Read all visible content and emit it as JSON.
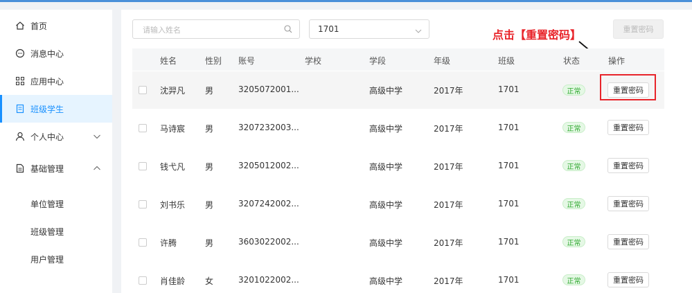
{
  "sidebar": {
    "items": [
      {
        "label": "首页",
        "icon": "home-icon"
      },
      {
        "label": "消息中心",
        "icon": "message-icon"
      },
      {
        "label": "应用中心",
        "icon": "apps-icon"
      },
      {
        "label": "班级学生",
        "icon": "document-icon",
        "active": true
      },
      {
        "label": "个人中心",
        "icon": "user-icon",
        "expand": "down"
      },
      {
        "label": "基础管理",
        "icon": "file-icon",
        "expand": "up"
      }
    ],
    "subitems": [
      {
        "label": "单位管理"
      },
      {
        "label": "班级管理"
      },
      {
        "label": "用户管理"
      }
    ]
  },
  "filters": {
    "search_placeholder": "请输入姓名",
    "class_select": "1701",
    "reset_button": "重置密码"
  },
  "annotation": "点击【重置密码】",
  "table": {
    "headers": [
      "姓名",
      "性别",
      "账号",
      "学校",
      "学段",
      "年级",
      "班级",
      "状态",
      "操作"
    ],
    "rows": [
      {
        "name": "沈羿凡",
        "gender": "男",
        "account": "3205072001...",
        "school": "",
        "stage": "高级中学",
        "grade": "2017年",
        "class": "1701",
        "status": "正常",
        "action": "重置密码"
      },
      {
        "name": "马诗宸",
        "gender": "男",
        "account": "3207232003...",
        "school": "",
        "stage": "高级中学",
        "grade": "2017年",
        "class": "1701",
        "status": "正常",
        "action": "重置密码"
      },
      {
        "name": "钱弋凡",
        "gender": "男",
        "account": "3205012002...",
        "school": "",
        "stage": "高级中学",
        "grade": "2017年",
        "class": "1701",
        "status": "正常",
        "action": "重置密码"
      },
      {
        "name": "刘书乐",
        "gender": "男",
        "account": "3207242002...",
        "school": "",
        "stage": "高级中学",
        "grade": "2017年",
        "class": "1701",
        "status": "正常",
        "action": "重置密码"
      },
      {
        "name": "许腾",
        "gender": "男",
        "account": "3603022002...",
        "school": "",
        "stage": "高级中学",
        "grade": "2017年",
        "class": "1701",
        "status": "正常",
        "action": "重置密码"
      },
      {
        "name": "肖佳龄",
        "gender": "女",
        "account": "3201022002...",
        "school": "",
        "stage": "高级中学",
        "grade": "2017年",
        "class": "1701",
        "status": "正常",
        "action": "重置密码"
      }
    ]
  },
  "colors": {
    "accent": "#1890ff",
    "annotation": "#e8242a",
    "status_ok": "#2ea82e"
  }
}
